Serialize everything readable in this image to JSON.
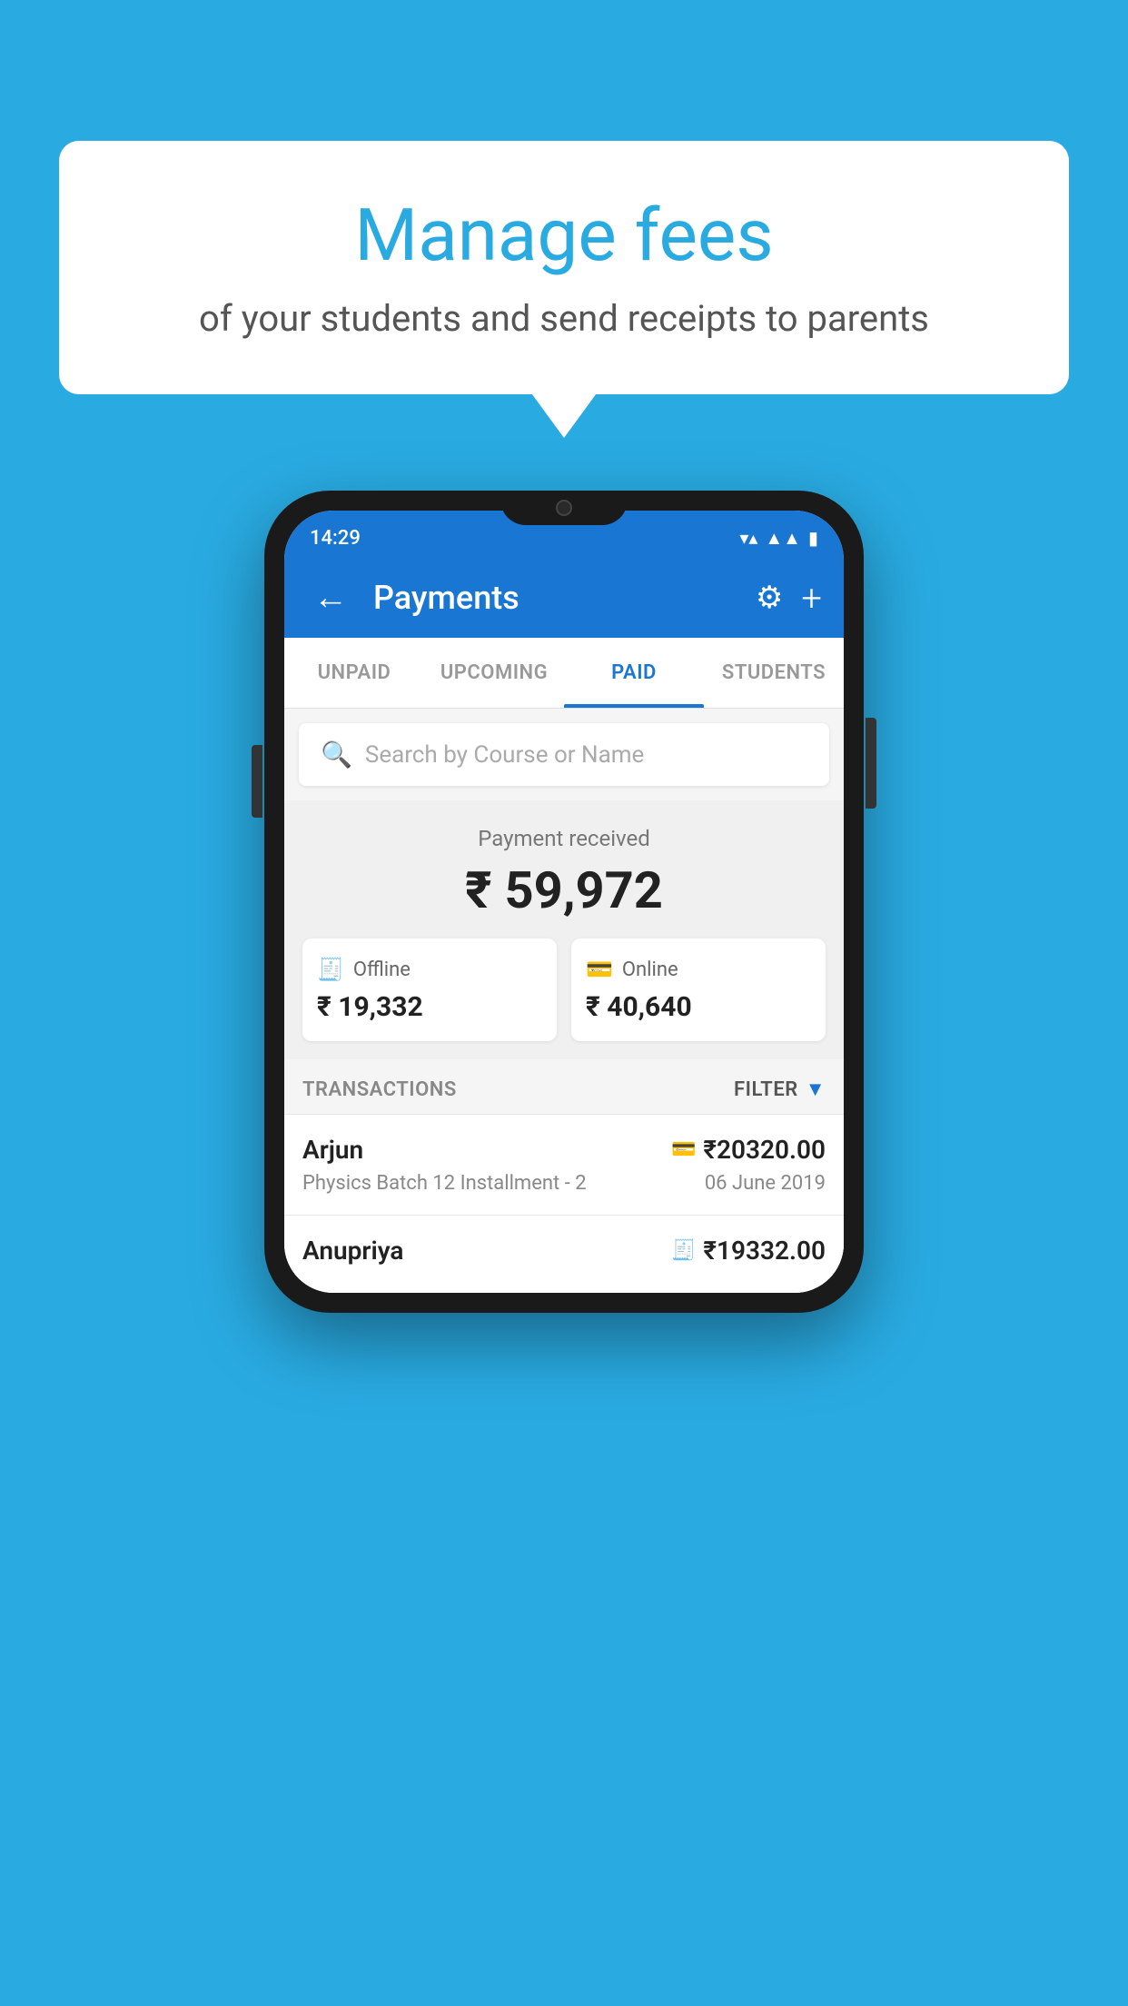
{
  "bubble": {
    "title": "Manage fees",
    "subtitle": "of your students and send receipts to parents"
  },
  "status_bar": {
    "time": "14:29",
    "wifi": "▾",
    "signal": "▲",
    "battery": "▮"
  },
  "app_bar": {
    "title": "Payments",
    "back_label": "←"
  },
  "tabs": [
    {
      "label": "UNPAID",
      "active": false
    },
    {
      "label": "UPCOMING",
      "active": false
    },
    {
      "label": "PAID",
      "active": true
    },
    {
      "label": "STUDENTS",
      "active": false
    }
  ],
  "search": {
    "placeholder": "Search by Course or Name"
  },
  "payment_summary": {
    "label": "Payment received",
    "amount": "₹ 59,972",
    "offline": {
      "label": "Offline",
      "amount": "₹ 19,332"
    },
    "online": {
      "label": "Online",
      "amount": "₹ 40,640"
    }
  },
  "transactions": {
    "header": "TRANSACTIONS",
    "filter": "FILTER",
    "items": [
      {
        "name": "Arjun",
        "amount": "₹20320.00",
        "course": "Physics Batch 12 Installment - 2",
        "date": "06 June 2019",
        "payment_type": "online"
      },
      {
        "name": "Anupriya",
        "amount": "₹19332.00",
        "course": "",
        "date": "",
        "payment_type": "offline"
      }
    ]
  }
}
